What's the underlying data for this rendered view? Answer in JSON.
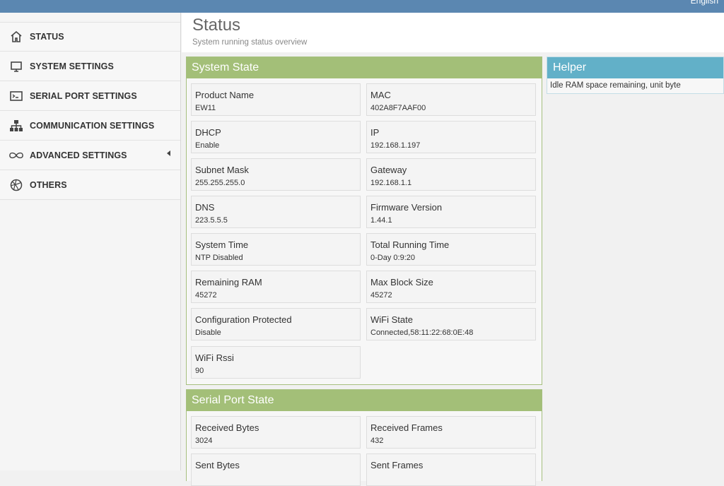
{
  "topbar": {
    "language": "English"
  },
  "sidebar": {
    "items": [
      {
        "label": "STATUS",
        "icon": "home-icon"
      },
      {
        "label": "SYSTEM SETTINGS",
        "icon": "monitor-icon"
      },
      {
        "label": "SERIAL PORT SETTINGS",
        "icon": "terminal-icon"
      },
      {
        "label": "COMMUNICATION SETTINGS",
        "icon": "network-icon"
      },
      {
        "label": "ADVANCED SETTINGS",
        "icon": "infinity-icon"
      },
      {
        "label": "OTHERS",
        "icon": "basketball-icon"
      }
    ]
  },
  "header": {
    "title": "Status",
    "subtitle": "System running status overview"
  },
  "system_state": {
    "title": "System State",
    "fields": [
      {
        "label": "Product Name",
        "value": "EW11"
      },
      {
        "label": "MAC",
        "value": "402A8F7AAF00"
      },
      {
        "label": "DHCP",
        "value": "Enable"
      },
      {
        "label": "IP",
        "value": "192.168.1.197"
      },
      {
        "label": "Subnet Mask",
        "value": "255.255.255.0"
      },
      {
        "label": "Gateway",
        "value": "192.168.1.1"
      },
      {
        "label": "DNS",
        "value": "223.5.5.5"
      },
      {
        "label": "Firmware Version",
        "value": "1.44.1"
      },
      {
        "label": "System Time",
        "value": "NTP Disabled"
      },
      {
        "label": "Total Running Time",
        "value": "0-Day 0:9:20"
      },
      {
        "label": "Remaining RAM",
        "value": "45272"
      },
      {
        "label": "Max Block Size",
        "value": "45272"
      },
      {
        "label": "Configuration Protected",
        "value": "Disable"
      },
      {
        "label": "WiFi State",
        "value": "Connected,58:11:22:68:0E:48"
      },
      {
        "label": "WiFi Rssi",
        "value": "90"
      }
    ]
  },
  "serial_state": {
    "title": "Serial Port State",
    "fields": [
      {
        "label": "Received Bytes",
        "value": "3024"
      },
      {
        "label": "Received Frames",
        "value": "432"
      },
      {
        "label": "Sent Bytes",
        "value": ""
      },
      {
        "label": "Sent Frames",
        "value": ""
      }
    ]
  },
  "helper": {
    "title": "Helper",
    "text": "Idle RAM space remaining, unit byte"
  },
  "colors": {
    "topbar": "#5b87b1",
    "panel_header": "#a3bf78",
    "helper_header": "#62b0c8"
  }
}
